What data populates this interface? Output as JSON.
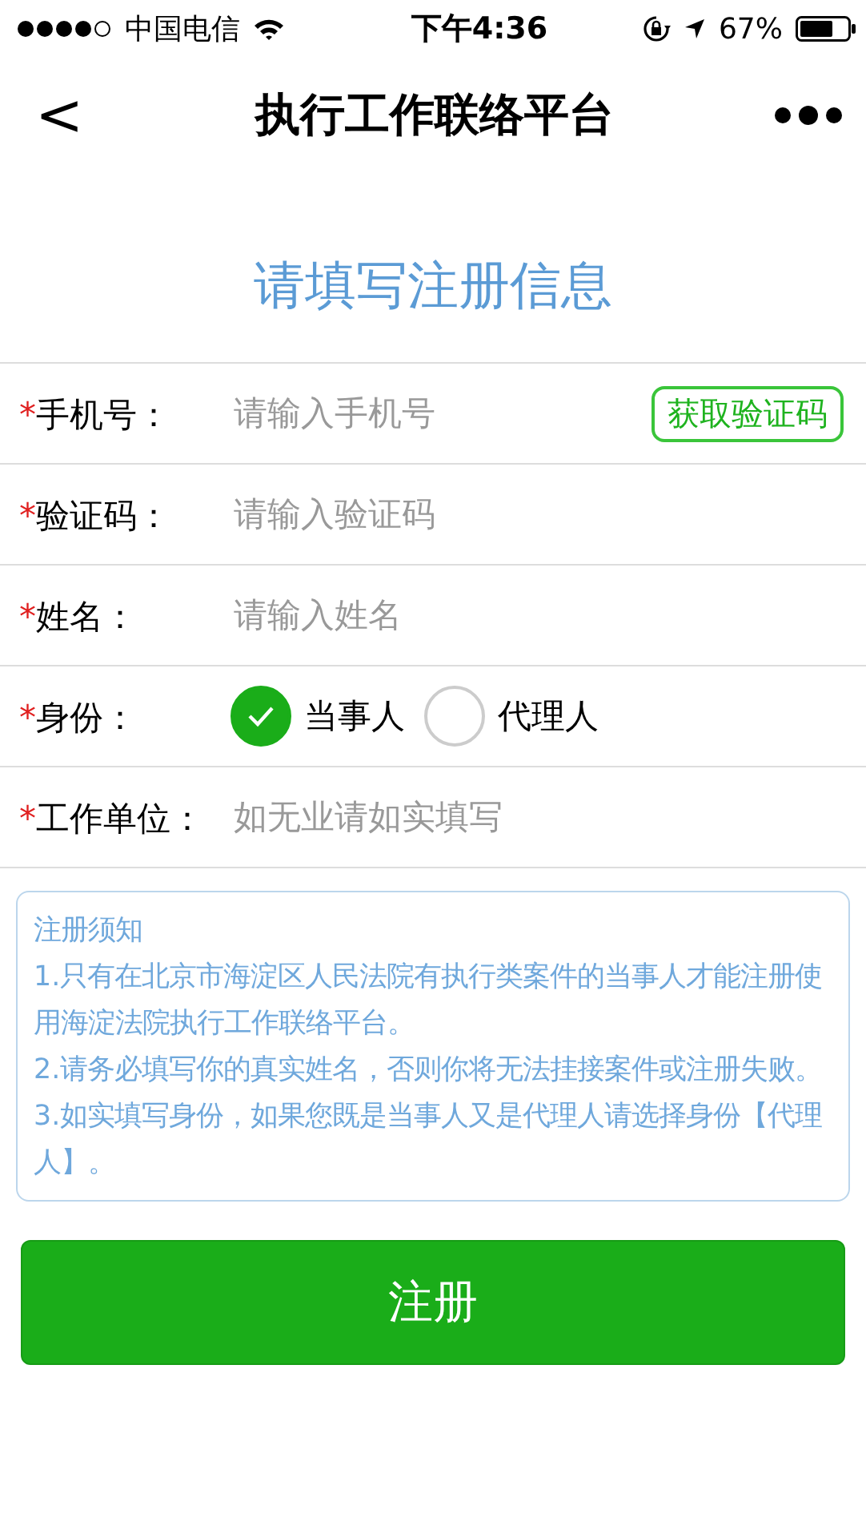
{
  "status_bar": {
    "carrier": "中国电信",
    "time": "下午4:36",
    "battery": "67%"
  },
  "nav": {
    "back": "<",
    "title": "执行工作联络平台"
  },
  "heading": "请填写注册信息",
  "fields": [
    {
      "kind": "input",
      "required_mark": "*",
      "label": "手机号：",
      "placeholder": "请输入手机号",
      "action": "获取验证码"
    },
    {
      "kind": "input",
      "required_mark": "*",
      "label": "验证码：",
      "placeholder": "请输入验证码"
    },
    {
      "kind": "input",
      "required_mark": "*",
      "label": "姓名：",
      "placeholder": "请输入姓名"
    },
    {
      "kind": "radio",
      "required_mark": "*",
      "label": "身份：",
      "options": [
        {
          "label": "当事人",
          "selected": true
        },
        {
          "label": "代理人",
          "selected": false
        }
      ]
    },
    {
      "kind": "input",
      "required_mark": "*",
      "label": "工作单位：",
      "placeholder": "如无业请如实填写"
    }
  ],
  "notice": {
    "title": "注册须知",
    "items": [
      "1.只有在北京市海淀区人民法院有执行类案件的当事人才能注册使用海淀法院执行工作联络平台。",
      "2.请务必填写你的真实姓名，否则你将无法挂接案件或注册失败。",
      "3.如实填写身份，如果您既是当事人又是代理人请选择身份【代理人】。"
    ]
  },
  "submit": "注册"
}
